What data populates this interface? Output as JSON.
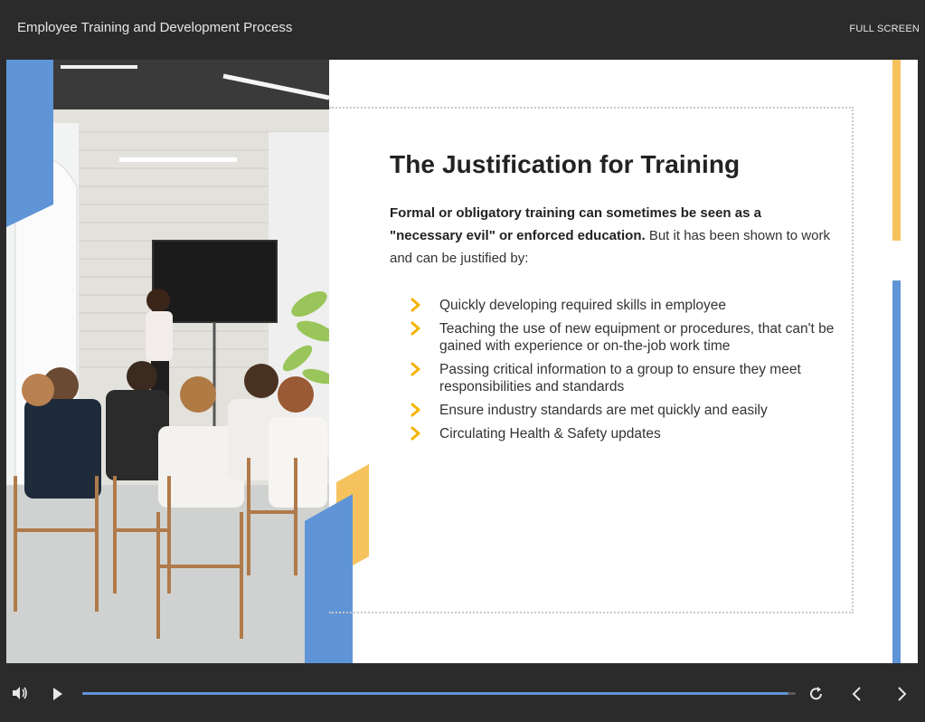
{
  "header": {
    "course_title": "Employee Training and Development Process",
    "fullscreen_label": "FULL SCREEN"
  },
  "slide": {
    "heading": "The Justification for Training",
    "intro_bold": "Formal or obligatory training can sometimes be seen as a \"necessary evil\" or enforced education.",
    "intro_rest": " But it has been shown to work and can be justified by:",
    "bullets": [
      "Quickly developing required skills in employee",
      "Teaching the use of new equipment or procedures, that can't be gained with experience or on-the-job work time",
      "Passing critical information to a group to ensure they meet responsibilities and standards",
      "Ensure industry standards are met quickly and easily",
      "Circulating Health & Safety updates"
    ],
    "photo_icon": "classroom-photo",
    "bullet_icon": "chevron-right-icon"
  },
  "player": {
    "progress": 0.99,
    "icons": {
      "volume": "volume-icon",
      "play": "play-icon",
      "replay": "replay-icon",
      "prev": "chevron-left-icon",
      "next": "chevron-right-icon"
    }
  },
  "colors": {
    "accent_blue": "#5f95d6",
    "accent_yellow": "#f6c25e",
    "chevron": "#f4b400",
    "chrome": "#2b2b2b"
  }
}
